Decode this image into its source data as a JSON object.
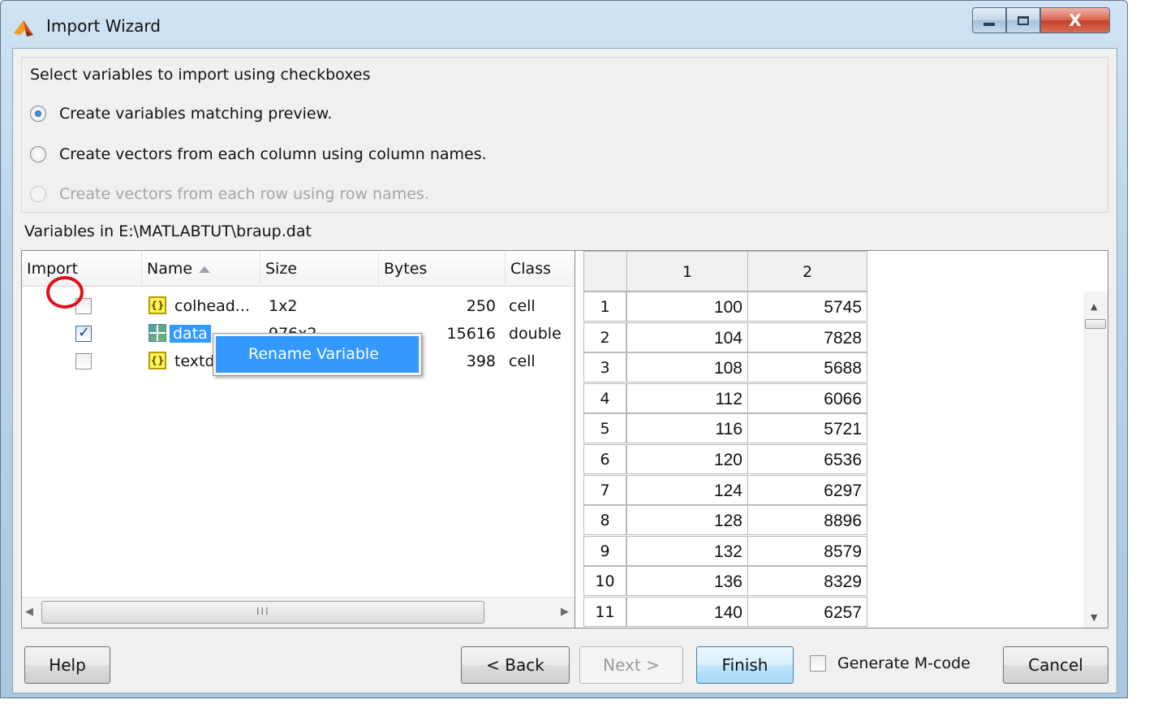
{
  "window": {
    "title": "Import Wizard",
    "close_symbol": "X"
  },
  "options": {
    "heading": "Select variables to import using checkboxes",
    "radios": [
      {
        "label": "Create variables matching preview.",
        "checked": true,
        "enabled": true
      },
      {
        "label": "Create vectors from each column using column names.",
        "checked": false,
        "enabled": true
      },
      {
        "label": "Create vectors from each row using row names.",
        "checked": false,
        "enabled": false
      }
    ]
  },
  "variables_label": "Variables in E:\\MATLABTUT\\braup.dat",
  "variables_table": {
    "columns": [
      "Import",
      "Name",
      "Size",
      "Bytes",
      "Class"
    ],
    "rows": [
      {
        "checked": false,
        "icon": "cell-array-icon",
        "name": "colhead...",
        "size": "1x2",
        "bytes": "250",
        "class": "cell"
      },
      {
        "checked": true,
        "icon": "matrix-icon",
        "name": "data",
        "size": "976x2",
        "bytes": "15616",
        "class": "double"
      },
      {
        "checked": false,
        "icon": "cell-array-icon",
        "name": "textdata",
        "size": "",
        "bytes": "398",
        "class": "cell"
      }
    ],
    "scroll_grip": "III"
  },
  "context_menu": {
    "items": [
      "Rename Variable"
    ]
  },
  "preview": {
    "columns": [
      "1",
      "2"
    ],
    "rows": [
      [
        "1",
        "100",
        "5745"
      ],
      [
        "2",
        "104",
        "7828"
      ],
      [
        "3",
        "108",
        "5688"
      ],
      [
        "4",
        "112",
        "6066"
      ],
      [
        "5",
        "116",
        "5721"
      ],
      [
        "6",
        "120",
        "6536"
      ],
      [
        "7",
        "124",
        "6297"
      ],
      [
        "8",
        "128",
        "8896"
      ],
      [
        "9",
        "132",
        "8579"
      ],
      [
        "10",
        "136",
        "8329"
      ],
      [
        "11",
        "140",
        "6257"
      ]
    ]
  },
  "buttons": {
    "help": "Help",
    "back": "< Back",
    "next": "Next >",
    "finish": "Finish",
    "generate_mcode": "Generate M-code",
    "cancel": "Cancel"
  },
  "colors": {
    "selection": "#3399ff",
    "highlight_circle": "#e0101a"
  }
}
